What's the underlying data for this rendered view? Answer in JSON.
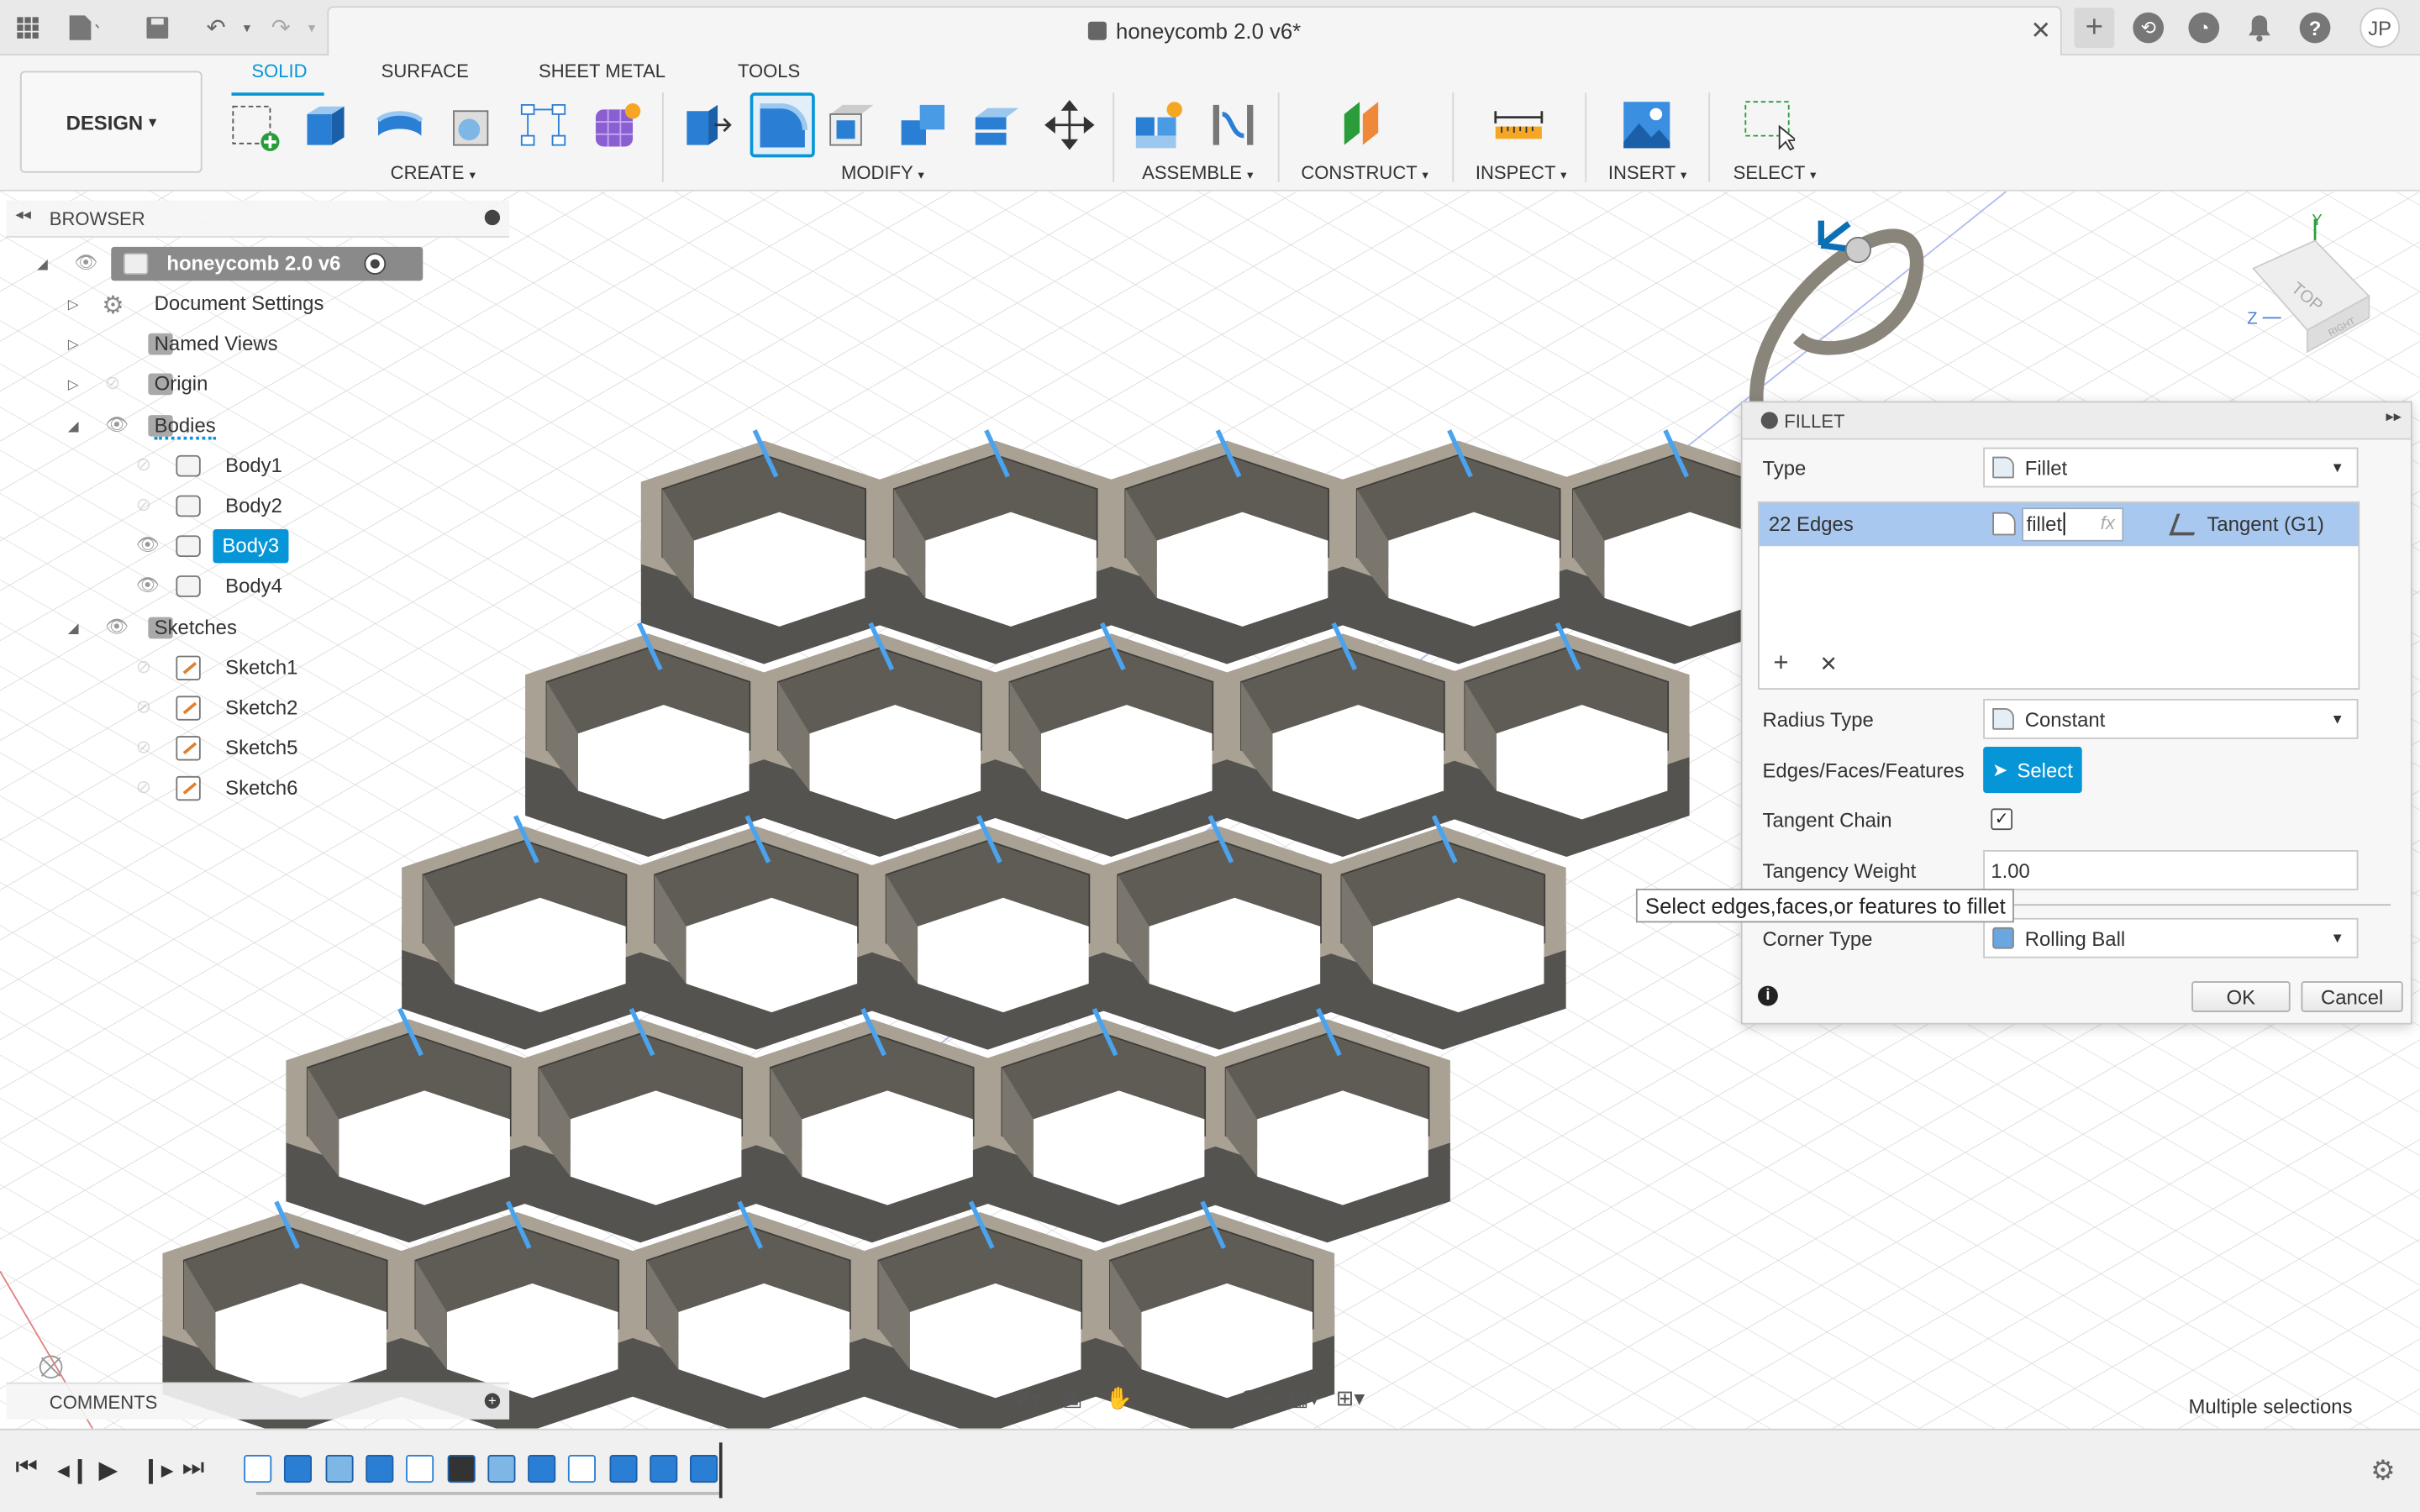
{
  "window": {
    "title": "honeycomb 2.0 v6*",
    "user_initials": "JP"
  },
  "toolbar": {
    "workspace": "DESIGN",
    "tabs": [
      "SOLID",
      "SURFACE",
      "SHEET METAL",
      "TOOLS"
    ],
    "active_tab": "SOLID",
    "groups": [
      "CREATE",
      "MODIFY",
      "ASSEMBLE",
      "CONSTRUCT",
      "INSPECT",
      "INSERT",
      "SELECT"
    ]
  },
  "browser": {
    "title": "BROWSER",
    "root": "honeycomb 2.0 v6",
    "items": [
      {
        "label": "Document Settings"
      },
      {
        "label": "Named Views"
      },
      {
        "label": "Origin"
      },
      {
        "label": "Bodies"
      },
      {
        "label": "Body1"
      },
      {
        "label": "Body2"
      },
      {
        "label": "Body3"
      },
      {
        "label": "Body4"
      },
      {
        "label": "Sketches"
      },
      {
        "label": "Sketch1"
      },
      {
        "label": "Sketch2"
      },
      {
        "label": "Sketch5"
      },
      {
        "label": "Sketch6"
      }
    ],
    "selected": "Body3"
  },
  "fillet_panel": {
    "title": "FILLET",
    "type_label": "Type",
    "type_value": "Fillet",
    "edges_label": "22 Edges",
    "radius_value": "fillet",
    "fx": "fx",
    "continuity": "Tangent (G1)",
    "radius_type_label": "Radius Type",
    "radius_type_value": "Constant",
    "eff_label": "Edges/Faces/Features",
    "select_label": "Select",
    "tangent_chain_label": "Tangent Chain",
    "tangent_chain_checked": true,
    "tangency_weight_label": "Tangency Weight",
    "tangency_weight_value": "1.00",
    "corner_type_label": "Corner Type",
    "corner_type_value": "Rolling Ball",
    "ok": "OK",
    "cancel": "Cancel"
  },
  "tooltip": "Select edges,faces,or features to fillet",
  "viewcube": {
    "top": "TOP",
    "side": "RIGHT"
  },
  "comments": {
    "title": "COMMENTS"
  },
  "status": {
    "right": "Multiple selections"
  },
  "colors": {
    "accent": "#0696d7",
    "model": "#a8a194",
    "model_shadow": "#5c5a55",
    "selected_edge": "#4aa3ef"
  }
}
